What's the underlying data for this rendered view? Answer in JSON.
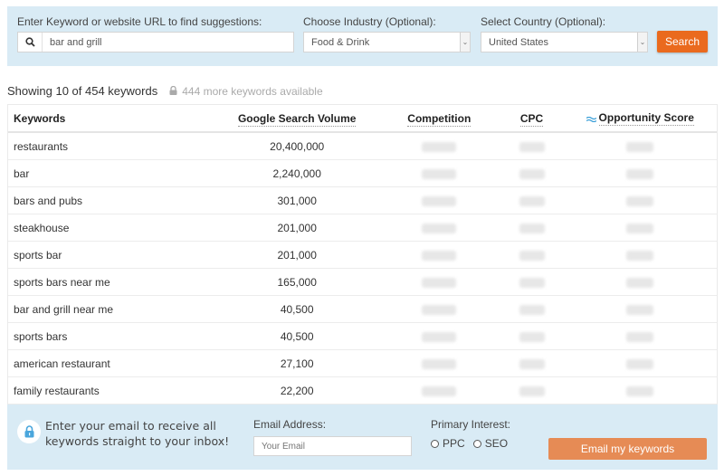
{
  "search": {
    "keyword_label": "Enter Keyword or website URL to find suggestions:",
    "keyword_value": "bar and grill",
    "industry_label": "Choose Industry (Optional):",
    "industry_value": "Food & Drink",
    "country_label": "Select Country (Optional):",
    "country_value": "United States",
    "search_button": "Search",
    "button_color": "#ea6a1e"
  },
  "summary": {
    "showing": "Showing 10 of 454 keywords",
    "more": "444 more keywords available"
  },
  "table": {
    "headers": {
      "keywords": "Keywords",
      "volume": "Google Search Volume",
      "competition": "Competition",
      "cpc": "CPC",
      "opportunity": "Opportunity Score"
    },
    "rows": [
      {
        "keyword": "restaurants",
        "volume": "20,400,000"
      },
      {
        "keyword": "bar",
        "volume": "2,240,000"
      },
      {
        "keyword": "bars and pubs",
        "volume": "301,000"
      },
      {
        "keyword": "steakhouse",
        "volume": "201,000"
      },
      {
        "keyword": "sports bar",
        "volume": "201,000"
      },
      {
        "keyword": "sports bars near me",
        "volume": "165,000"
      },
      {
        "keyword": "bar and grill near me",
        "volume": "40,500"
      },
      {
        "keyword": "sports bars",
        "volume": "40,500"
      },
      {
        "keyword": "american restaurant",
        "volume": "27,100"
      },
      {
        "keyword": "family restaurants",
        "volume": "22,200"
      }
    ]
  },
  "email_capture": {
    "promo_line1": "Enter your email to receive all",
    "promo_line2": "keywords straight to your inbox!",
    "email_label": "Email Address:",
    "email_placeholder": "Your Email",
    "interest_label": "Primary Interest:",
    "options": [
      "PPC",
      "SEO"
    ],
    "submit_button": "Email my keywords",
    "button_color": "#e68b55"
  }
}
